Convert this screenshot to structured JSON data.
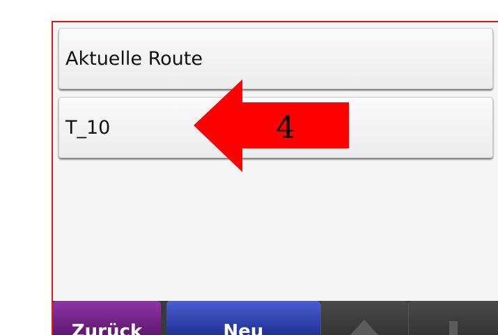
{
  "list": {
    "items": [
      {
        "label": "Aktuelle Route"
      },
      {
        "label": "T_10"
      }
    ]
  },
  "toolbar": {
    "back_label": "Zurück",
    "new_label": "Neu",
    "up_icon": "arrow-up-icon",
    "down_icon": "arrow-down-icon"
  },
  "annotation": {
    "step_number": "4",
    "arrow_color": "#ff0000",
    "frame_color": "#e01818"
  }
}
